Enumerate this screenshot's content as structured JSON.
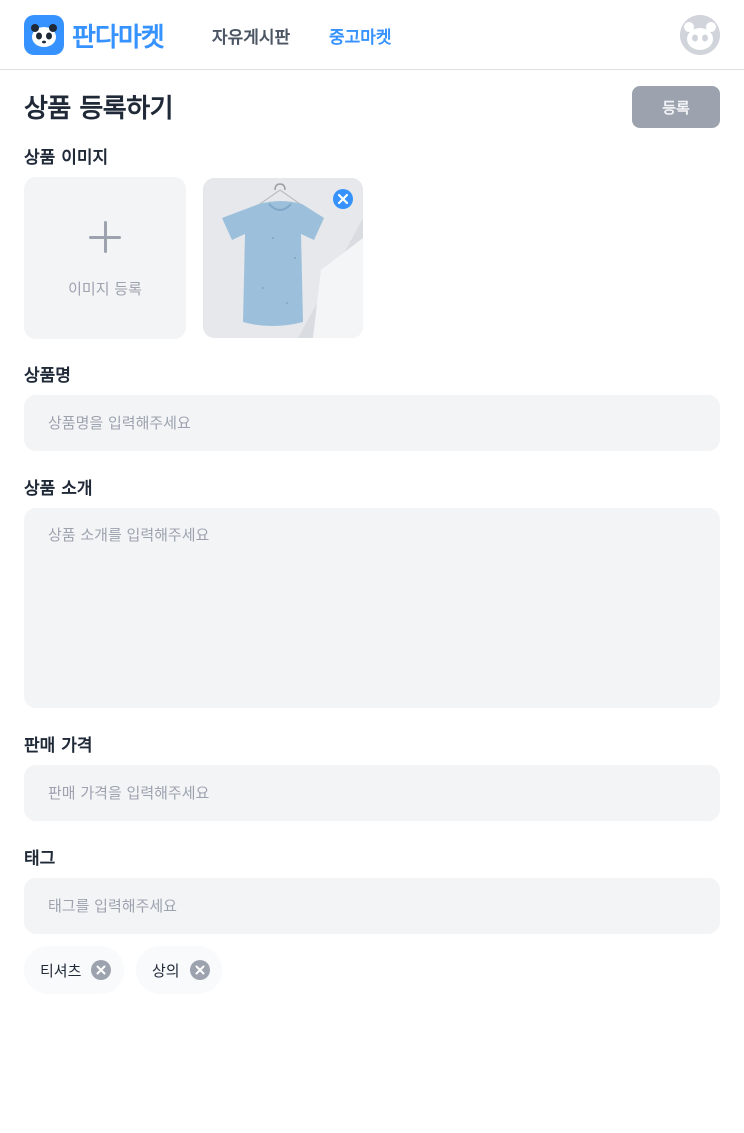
{
  "header": {
    "logo_text": "판다마켓",
    "nav": {
      "free_board": "자유게시판",
      "market": "중고마켓"
    }
  },
  "page": {
    "title": "상품 등록하기",
    "submit_label": "등록"
  },
  "images_section": {
    "label": "상품 이미지",
    "upload_label": "이미지 등록"
  },
  "name_section": {
    "label": "상품명",
    "placeholder": "상품명을 입력해주세요"
  },
  "description_section": {
    "label": "상품 소개",
    "placeholder": "상품 소개를 입력해주세요"
  },
  "price_section": {
    "label": "판매 가격",
    "placeholder": "판매 가격을 입력해주세요"
  },
  "tag_section": {
    "label": "태그",
    "placeholder": "태그를 입력해주세요",
    "tags": [
      "티셔츠",
      "상의"
    ]
  },
  "colors": {
    "accent": "#3692ff",
    "disabled_button": "#9ca3af",
    "field_bg": "#f3f4f6"
  }
}
